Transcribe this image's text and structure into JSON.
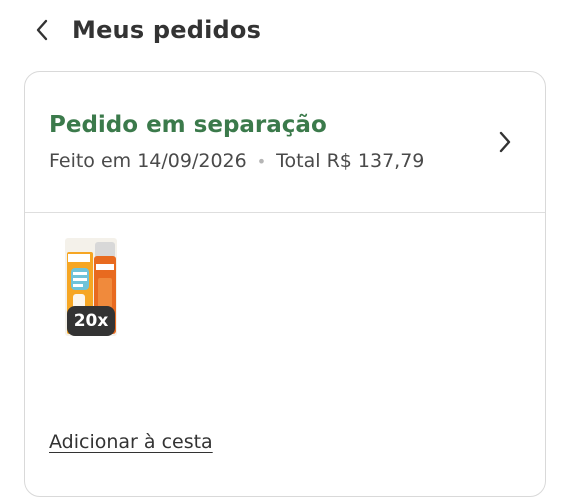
{
  "header": {
    "title": "Meus pedidos",
    "back_icon": "chevron-left-icon"
  },
  "order": {
    "status": "Pedido em separação",
    "placed_on": "Feito em 14/09/2026",
    "separator": "•",
    "total": "Total R$ 137,79",
    "status_color": "#3b7a4b",
    "detail_icon": "chevron-right-icon",
    "items": [
      {
        "image": "sunscreen-kit-image",
        "quantity": "20x"
      }
    ],
    "add_to_basket_label": "Adicionar à cesta"
  }
}
